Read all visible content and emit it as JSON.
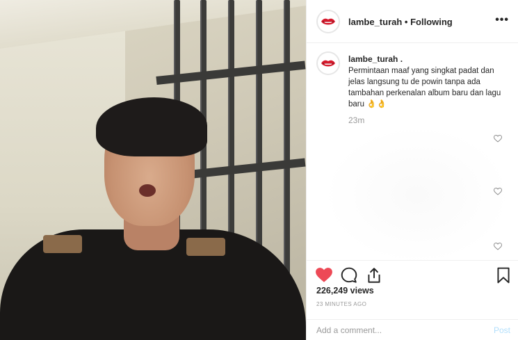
{
  "header": {
    "username": "lambe_turah",
    "separator": " • ",
    "follow_status": "Following",
    "more_glyph": "•••"
  },
  "caption": {
    "username": "lambe_turah .",
    "text": "Permintaan maaf yang singkat padat dan jelas langsung tu de powin tanpa ada tambahan perkenalan album baru dan lagu baru 👌👌",
    "time": "23m"
  },
  "comment_likes": [
    {
      "icon": "heart-outline-icon"
    },
    {
      "icon": "heart-outline-icon"
    },
    {
      "icon": "heart-outline-icon"
    }
  ],
  "actions": {
    "views": "226,249 views",
    "posted_ago": "23 MINUTES AGO",
    "like_color": "#ed4956"
  },
  "comment_box": {
    "placeholder": "Add a comment...",
    "post_label": "Post"
  }
}
